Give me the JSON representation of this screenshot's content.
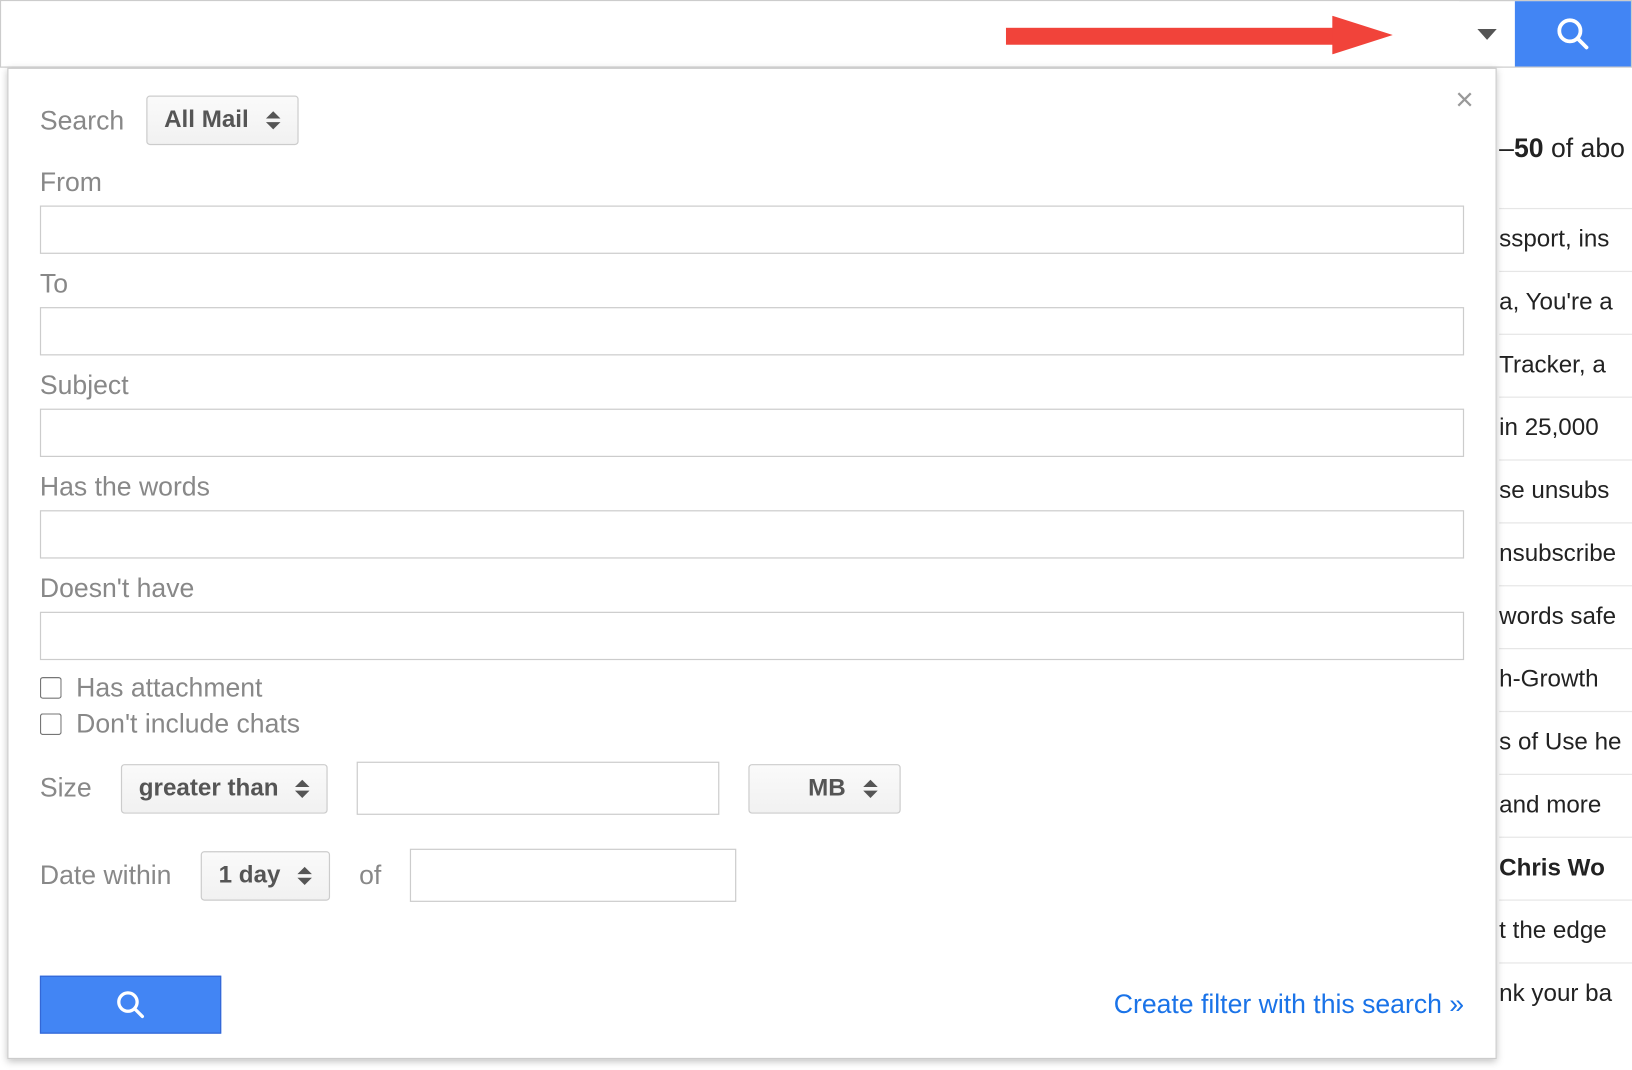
{
  "searchbar": {
    "query": "",
    "placeholder": ""
  },
  "panel": {
    "search_label": "Search",
    "scope_value": "All Mail",
    "from_label": "From",
    "from_value": "",
    "to_label": "To",
    "to_value": "",
    "subject_label": "Subject",
    "subject_value": "",
    "has_words_label": "Has the words",
    "has_words_value": "",
    "doesnt_have_label": "Doesn't have",
    "doesnt_have_value": "",
    "has_attachment_label": "Has attachment",
    "exclude_chats_label": "Don't include chats",
    "size_label": "Size",
    "size_comparator": "greater than",
    "size_value": "",
    "size_unit": "MB",
    "date_within_label": "Date within",
    "date_within_value": "1 day",
    "of_label": "of",
    "date_value": "",
    "filter_link": "Create filter with this search »"
  },
  "background": {
    "counter_prefix": "–",
    "counter_bold": "50",
    "counter_suffix": " of abo",
    "rows": [
      {
        "text": "ssport, ins",
        "bold": false
      },
      {
        "text": "a, You're a",
        "bold": false
      },
      {
        "text": " Tracker, a",
        "bold": false
      },
      {
        "text": "in 25,000 ",
        "bold": false
      },
      {
        "text": "se unsubs",
        "bold": false
      },
      {
        "text": "nsubscribe",
        "bold": false
      },
      {
        "text": "words safe",
        "bold": false
      },
      {
        "text": "h-Growth ",
        "bold": false
      },
      {
        "text": "s of Use he",
        "bold": false
      },
      {
        "text": " and more ",
        "bold": false
      },
      {
        "text": "Chris Wo",
        "bold": true
      },
      {
        "text": "t the edge ",
        "bold": false
      },
      {
        "text": "nk your ba",
        "bold": false
      }
    ]
  }
}
